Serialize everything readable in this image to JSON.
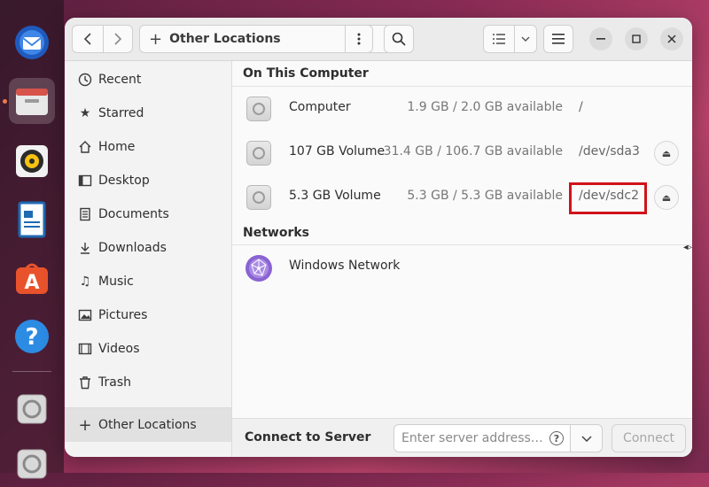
{
  "window": {
    "location": "Other Locations"
  },
  "sidebar": {
    "items": [
      {
        "label": "Recent",
        "icon": "clock-icon"
      },
      {
        "label": "Starred",
        "icon": "star-icon"
      },
      {
        "label": "Home",
        "icon": "home-icon"
      },
      {
        "label": "Desktop",
        "icon": "desktop-icon"
      },
      {
        "label": "Documents",
        "icon": "document-icon"
      },
      {
        "label": "Downloads",
        "icon": "download-icon"
      },
      {
        "label": "Music",
        "icon": "music-icon"
      },
      {
        "label": "Pictures",
        "icon": "picture-icon"
      },
      {
        "label": "Videos",
        "icon": "video-icon"
      },
      {
        "label": "Trash",
        "icon": "trash-icon"
      }
    ],
    "other_locations": "Other Locations"
  },
  "main": {
    "on_this_computer": "On This Computer",
    "devices": [
      {
        "name": "Computer",
        "space": "1.9 GB / 2.0 GB available",
        "path": "/"
      },
      {
        "name": "107 GB Volume",
        "space": "31.4 GB / 106.7 GB available",
        "path": "/dev/sda3"
      },
      {
        "name": "5.3 GB Volume",
        "space": "5.3 GB / 5.3 GB available",
        "path": "/dev/sdc2"
      }
    ],
    "networks": "Networks",
    "network_items": [
      {
        "name": "Windows Network"
      }
    ]
  },
  "footer": {
    "label": "Connect to Server",
    "placeholder": "Enter server address…",
    "help": "?",
    "connect": "Connect"
  },
  "colors": {
    "highlight": "#d0121b",
    "window_bg": "#fafafa",
    "header_bg": "#ebebeb"
  }
}
